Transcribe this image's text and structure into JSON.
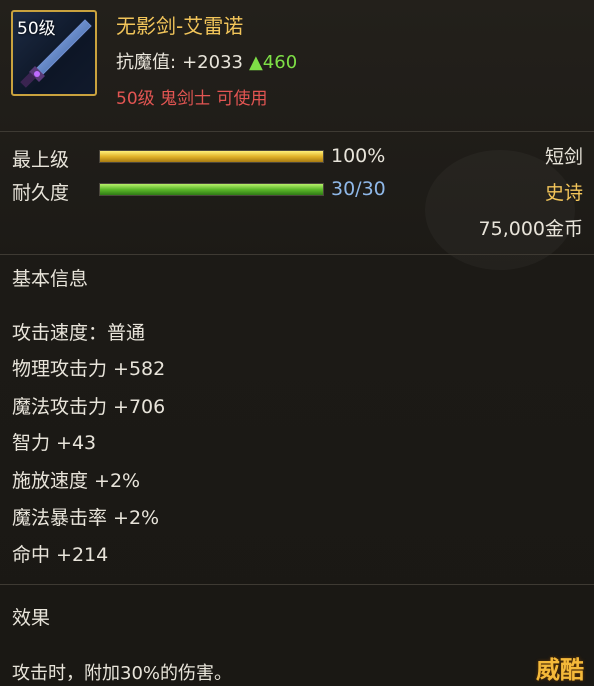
{
  "item": {
    "level_badge": "50级",
    "name": "无影剑-艾雷诺",
    "resist_label": "抗魔值:",
    "resist_value": "+2033",
    "resist_upgrade": "▲460",
    "requirement": "50级 鬼剑士 可使用"
  },
  "bars": {
    "max_level": {
      "label": "最上级",
      "value_text": "100%",
      "fill_fraction": 1.0
    },
    "durability": {
      "label": "耐久度",
      "value_text": "30/30",
      "fill_fraction": 1.0
    }
  },
  "side": {
    "type": "短剑",
    "rarity": "史诗",
    "price": "75,000金币"
  },
  "basic_info": {
    "title": "基本信息",
    "stats": [
      "攻击速度：普通",
      "物理攻击力 +582",
      "魔法攻击力 +706",
      "智力 +43",
      "施放速度 +2%",
      "魔法暴击率 +2%",
      "命中 +214"
    ]
  },
  "effect": {
    "title": "效果",
    "text": "攻击时，附加30%的伤害。"
  },
  "watermark": "威酷",
  "colors": {
    "name": "#f2c55a",
    "rarity": "#f2c55a",
    "requirement": "#e25552",
    "upgrade": "#7ee046",
    "durability_value": "#8fb8e8",
    "border": "#c9a23e"
  },
  "icons": [
    "sword-item-icon"
  ]
}
